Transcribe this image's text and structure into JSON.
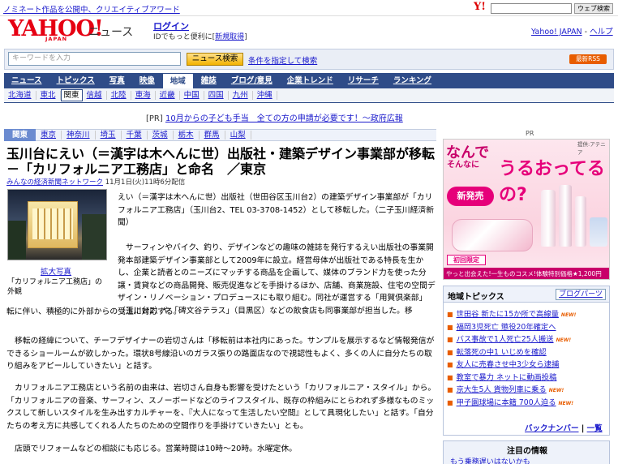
{
  "topbar": {
    "promo": "ノミネート作品を公開中、クリエイティブアワード",
    "yahoo_mark": "Y!",
    "search_button": "ウェブ検索"
  },
  "header": {
    "logo": "YAHOO!",
    "logo_sub": "JAPAN",
    "service": "ニュース",
    "login": "ログイン",
    "login_sub_prefix": "IDでもっと便利に[",
    "register": "新規取得",
    "login_sub_suffix": "]",
    "yahoo_japan_link": "Yahoo! JAPAN",
    "help_sep": " - ",
    "help_link": "ヘルプ"
  },
  "search": {
    "placeholder": "キーワードを入力",
    "button": "ニュース検索",
    "advanced": "条件を指定して検索",
    "rss": "最新RSS"
  },
  "nav": {
    "tabs": [
      "ニュース",
      "トピックス",
      "写真",
      "映像",
      "地域",
      "雑誌",
      "ブログ/意見",
      "企業トレンド",
      "リサーチ",
      "ランキング"
    ],
    "active": "地域"
  },
  "subnav": {
    "items": [
      "北海道",
      "東北",
      "関東",
      "信越",
      "北陸",
      "東海",
      "近畿",
      "中国",
      "四国",
      "九州",
      "沖縄"
    ],
    "active": "関東"
  },
  "pr": {
    "prefix": "[PR] ",
    "link": "10月からの子ども手当　全ての方の申請が必要です！～政府広報",
    "label": "PR"
  },
  "region_bar": {
    "items": [
      "関東",
      "東京",
      "神奈川",
      "埼玉",
      "千葉",
      "茨城",
      "栃木",
      "群馬",
      "山梨"
    ],
    "active": "関東"
  },
  "article": {
    "headline": "玉川台にえい（＝漢字は木へんに世）出版社・建築デザイン事業部が移転－「カリフォルニア工務店」と命名　／東京",
    "source": "みんなの経済新聞ネットワーク",
    "date": " 11月1日(火)11時6分配信",
    "photo_link": "拡大写真",
    "photo_caption": "「カリフォルニア工務店」の外観",
    "p1": "えい（＝漢字は木へんに世）出版社（世田谷区玉川台2）の建築デザイン事業部が「カリフォルニア工務店」（玉川台2、TEL 03-3708-1452）として移転した。（二子玉川経済新聞）",
    "p2a": "サーフィンやバイク、釣り、デザインなどの趣味の雑誌を発行するえい出版社の事業開発本部建築デザイン事業部として2009年に設立。経営母体が出版社である特長を生かし、企業と読者とのニーズにマッチする商品を企画して、媒体のブランド力を使った分譲・賃貸などの商品開発、販売促進などを手掛けるほか、店舗、商業施設、住宅の空間デザイン・リノベーション・プロデュースにも取り組む。同社が運営する「用賀倶楽部」（玉川台2）や「碑文谷テラス」（目黒区）などの飲食店も同事業部が担当した。移",
    "p2b": "転に伴い、積極的に外部からの受注に対応する。",
    "p3": "移転の経緯について、チーフデザイナーの岩切さんは「移転前は本社内にあった。サンプルを展示するなど情報発信ができるショールームが欲しかった。環状8号線沿いのガラス張りの路面店なので視認性もよく、多くの人に自分たちの取り組みをアピールしていきたい」と話す。",
    "p4": "カリフォルニア工務店という名前の由来は、岩切さん自身も影響を受けたという「カリフォルニア・スタイル」から。「カリフォルニアの音楽、サーフィン、スノーボードなどのライフスタイル、既存の枠組みにとらわれず多様なものミックスして新しいスタイルを生み出すカルチャーを、『大人になって生活したい空間』として具現化したい」と話す。「自分たちの考え方に共感してくれる人たちのための空間作りを手掛けていきたい」とも。",
    "p5": "店頭でリフォームなどの相談にも応じる。営業時間は10時～20時。水曜定休。"
  },
  "ad": {
    "line1": "なんで",
    "line2": "そんなに",
    "line3": "うるおってるの?",
    "provider": "提供:アテニア",
    "badge": "新発売",
    "limited": "初回限定",
    "bottom": "やっと出会えた!一生ものコスメ!体験特別価格★1,200円"
  },
  "topics": {
    "title": "地域トピックス",
    "blog_button": "ブログパーツ",
    "items": [
      {
        "text": "世田谷 新たに15か所で高線量",
        "new": true
      },
      {
        "text": "福岡3児死亡 懲役20年確定へ",
        "new": false
      },
      {
        "text": "バス事故で1人死亡25人搬送",
        "new": true
      },
      {
        "text": "転落死の中1 いじめを確認",
        "new": false
      },
      {
        "text": "友人に売春させ中3少女ら逮捕",
        "new": false
      },
      {
        "text": "教室で暴力 ネットに動画投稿",
        "new": false
      },
      {
        "text": "京大生5人 貨物列車に乗る",
        "new": true
      },
      {
        "text": "甲子園球場に本籍 700人迫る",
        "new": true
      }
    ],
    "backnumber": "バックナンバー",
    "sep": " | ",
    "list": "一覧"
  },
  "attention": {
    "title": "注目の情報",
    "item": "もう乗務遅いはないかも"
  }
}
